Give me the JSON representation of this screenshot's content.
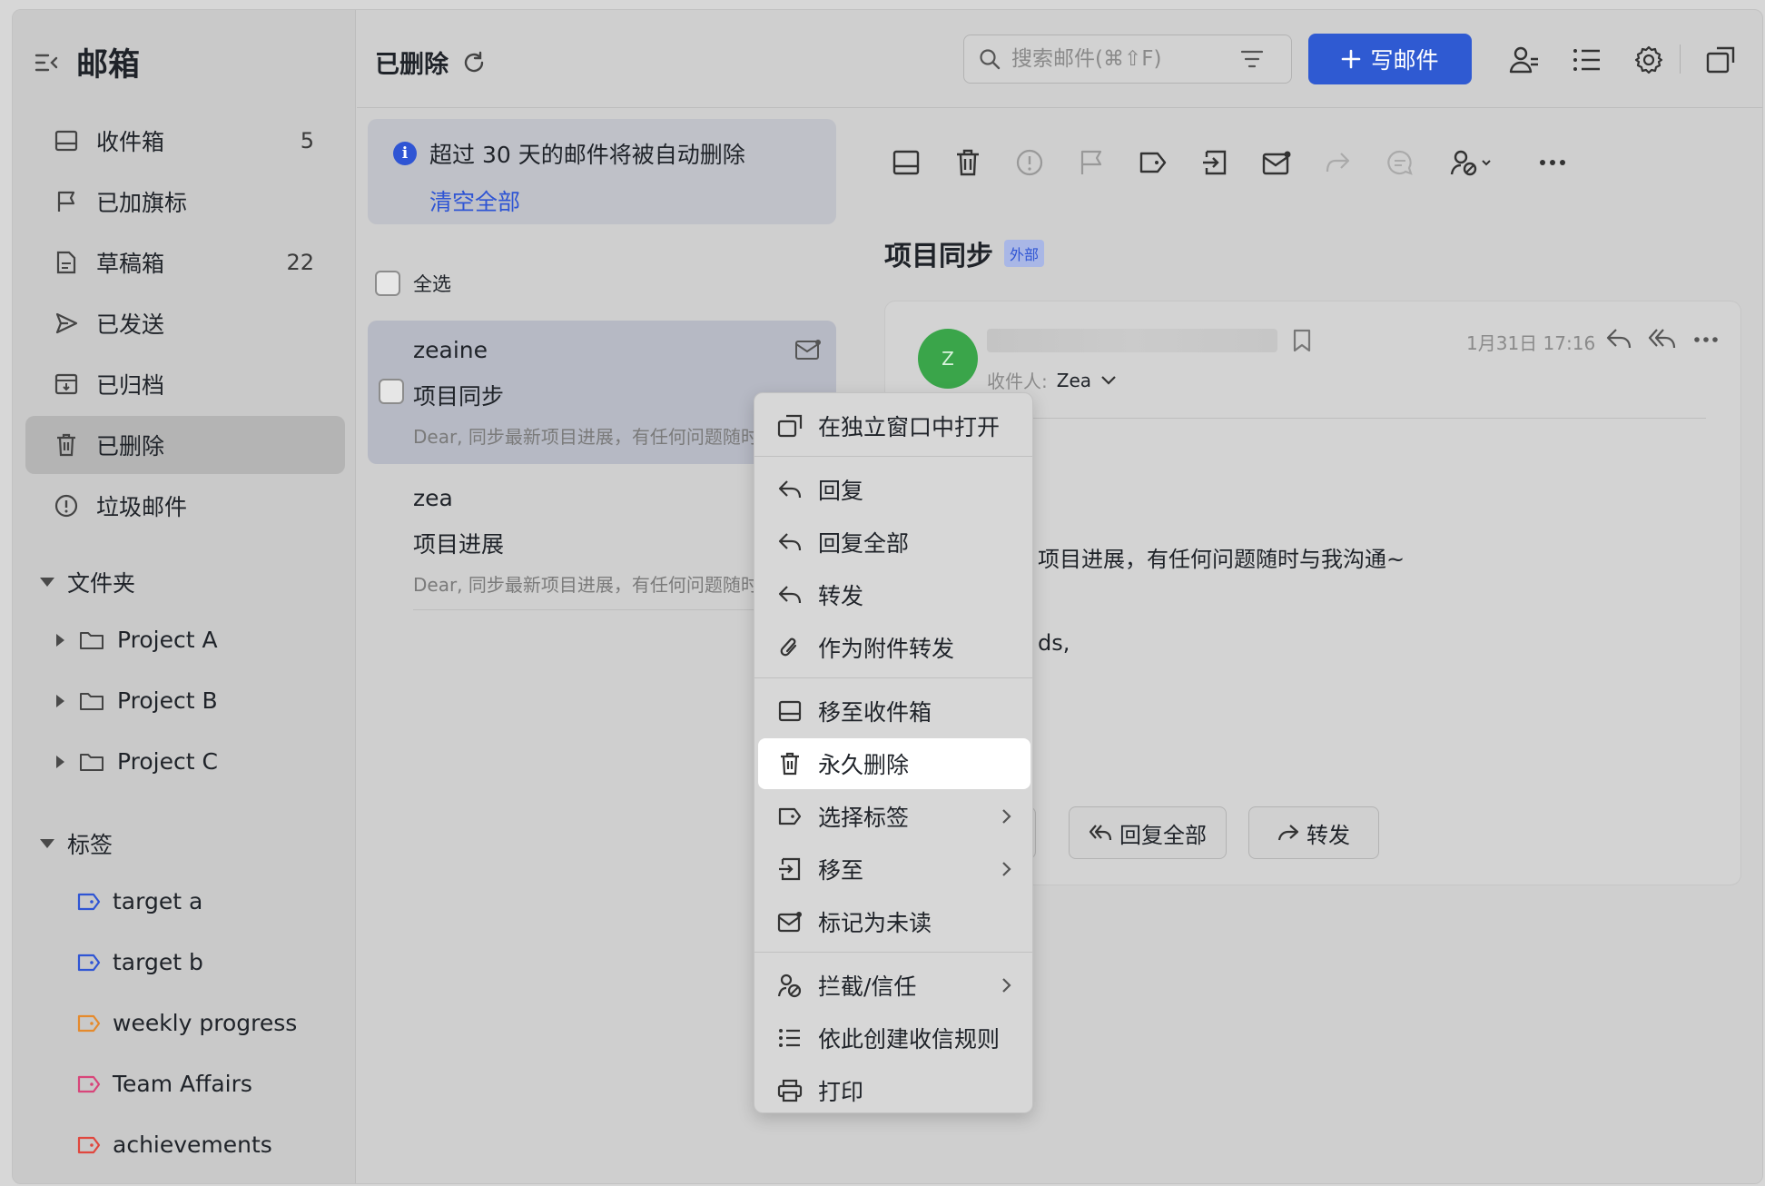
{
  "sidebar": {
    "title": "邮箱",
    "items": [
      {
        "label": "收件箱",
        "count": "5",
        "icon": "inbox-icon"
      },
      {
        "label": "已加旗标",
        "count": "",
        "icon": "flag-icon"
      },
      {
        "label": "草稿箱",
        "count": "22",
        "icon": "draft-icon"
      },
      {
        "label": "已发送",
        "count": "",
        "icon": "send-icon"
      },
      {
        "label": "已归档",
        "count": "",
        "icon": "archive-icon"
      },
      {
        "label": "已删除",
        "count": "",
        "icon": "trash-icon",
        "active": true
      },
      {
        "label": "垃圾邮件",
        "count": "",
        "icon": "spam-icon"
      }
    ],
    "folders_label": "文件夹",
    "folders": [
      "Project A",
      "Project B",
      "Project C"
    ],
    "tags_label": "标签",
    "tags": [
      {
        "label": "target a",
        "color": "#2f55d4"
      },
      {
        "label": "target b",
        "color": "#2f55d4"
      },
      {
        "label": "weekly progress",
        "color": "#e58a2c"
      },
      {
        "label": "Team Affairs",
        "color": "#d8457a"
      },
      {
        "label": "achievements",
        "color": "#e0473e"
      }
    ]
  },
  "list": {
    "title": "已删除",
    "notice": "超过 30 天的邮件将被自动删除",
    "notice_link": "清空全部",
    "select_all": "全选",
    "mails": [
      {
        "sender": "zeaine",
        "subject": "项目同步",
        "preview": "Dear, 同步最新项目进展，有任何问题随时与我沟通~"
      },
      {
        "sender": "zea",
        "subject": "项目进展",
        "preview": "Dear, 同步最新项目进展，有任何问题随时与我沟通~"
      }
    ]
  },
  "topbar": {
    "search_placeholder": "搜索邮件(⌘⇧F)",
    "compose": "写邮件"
  },
  "reader": {
    "subject": "项目同步",
    "badge": "外部",
    "recipient_label": "收件人:",
    "recipient": "Zea",
    "avatar_letter": "Z",
    "date": "1月31日 17:16",
    "body_line1": "项目进展，有任何问题随时与我沟通~",
    "body_line2": "ds,",
    "btn_reply_all": "回复全部",
    "btn_forward": "转发"
  },
  "menu": {
    "items": [
      {
        "label": "在独立窗口中打开",
        "icon": "open-window-icon"
      },
      {
        "label": "回复",
        "icon": "reply-icon"
      },
      {
        "label": "回复全部",
        "icon": "reply-all-icon"
      },
      {
        "label": "转发",
        "icon": "forward-icon"
      },
      {
        "label": "作为附件转发",
        "icon": "attachment-icon"
      },
      {
        "label": "移至收件箱",
        "icon": "inbox-icon"
      },
      {
        "label": "永久删除",
        "icon": "trash-icon",
        "highlighted": true
      },
      {
        "label": "选择标签",
        "icon": "tag-icon",
        "submenu": true
      },
      {
        "label": "移至",
        "icon": "move-icon",
        "submenu": true
      },
      {
        "label": "标记为未读",
        "icon": "unread-icon"
      },
      {
        "label": "拦截/信任",
        "icon": "block-trust-icon",
        "submenu": true
      },
      {
        "label": "依此创建收信规则",
        "icon": "rule-icon"
      },
      {
        "label": "打印",
        "icon": "print-icon"
      }
    ]
  },
  "colors": {
    "accent": "#2f5ad2",
    "avatar": "#3aa54a"
  }
}
